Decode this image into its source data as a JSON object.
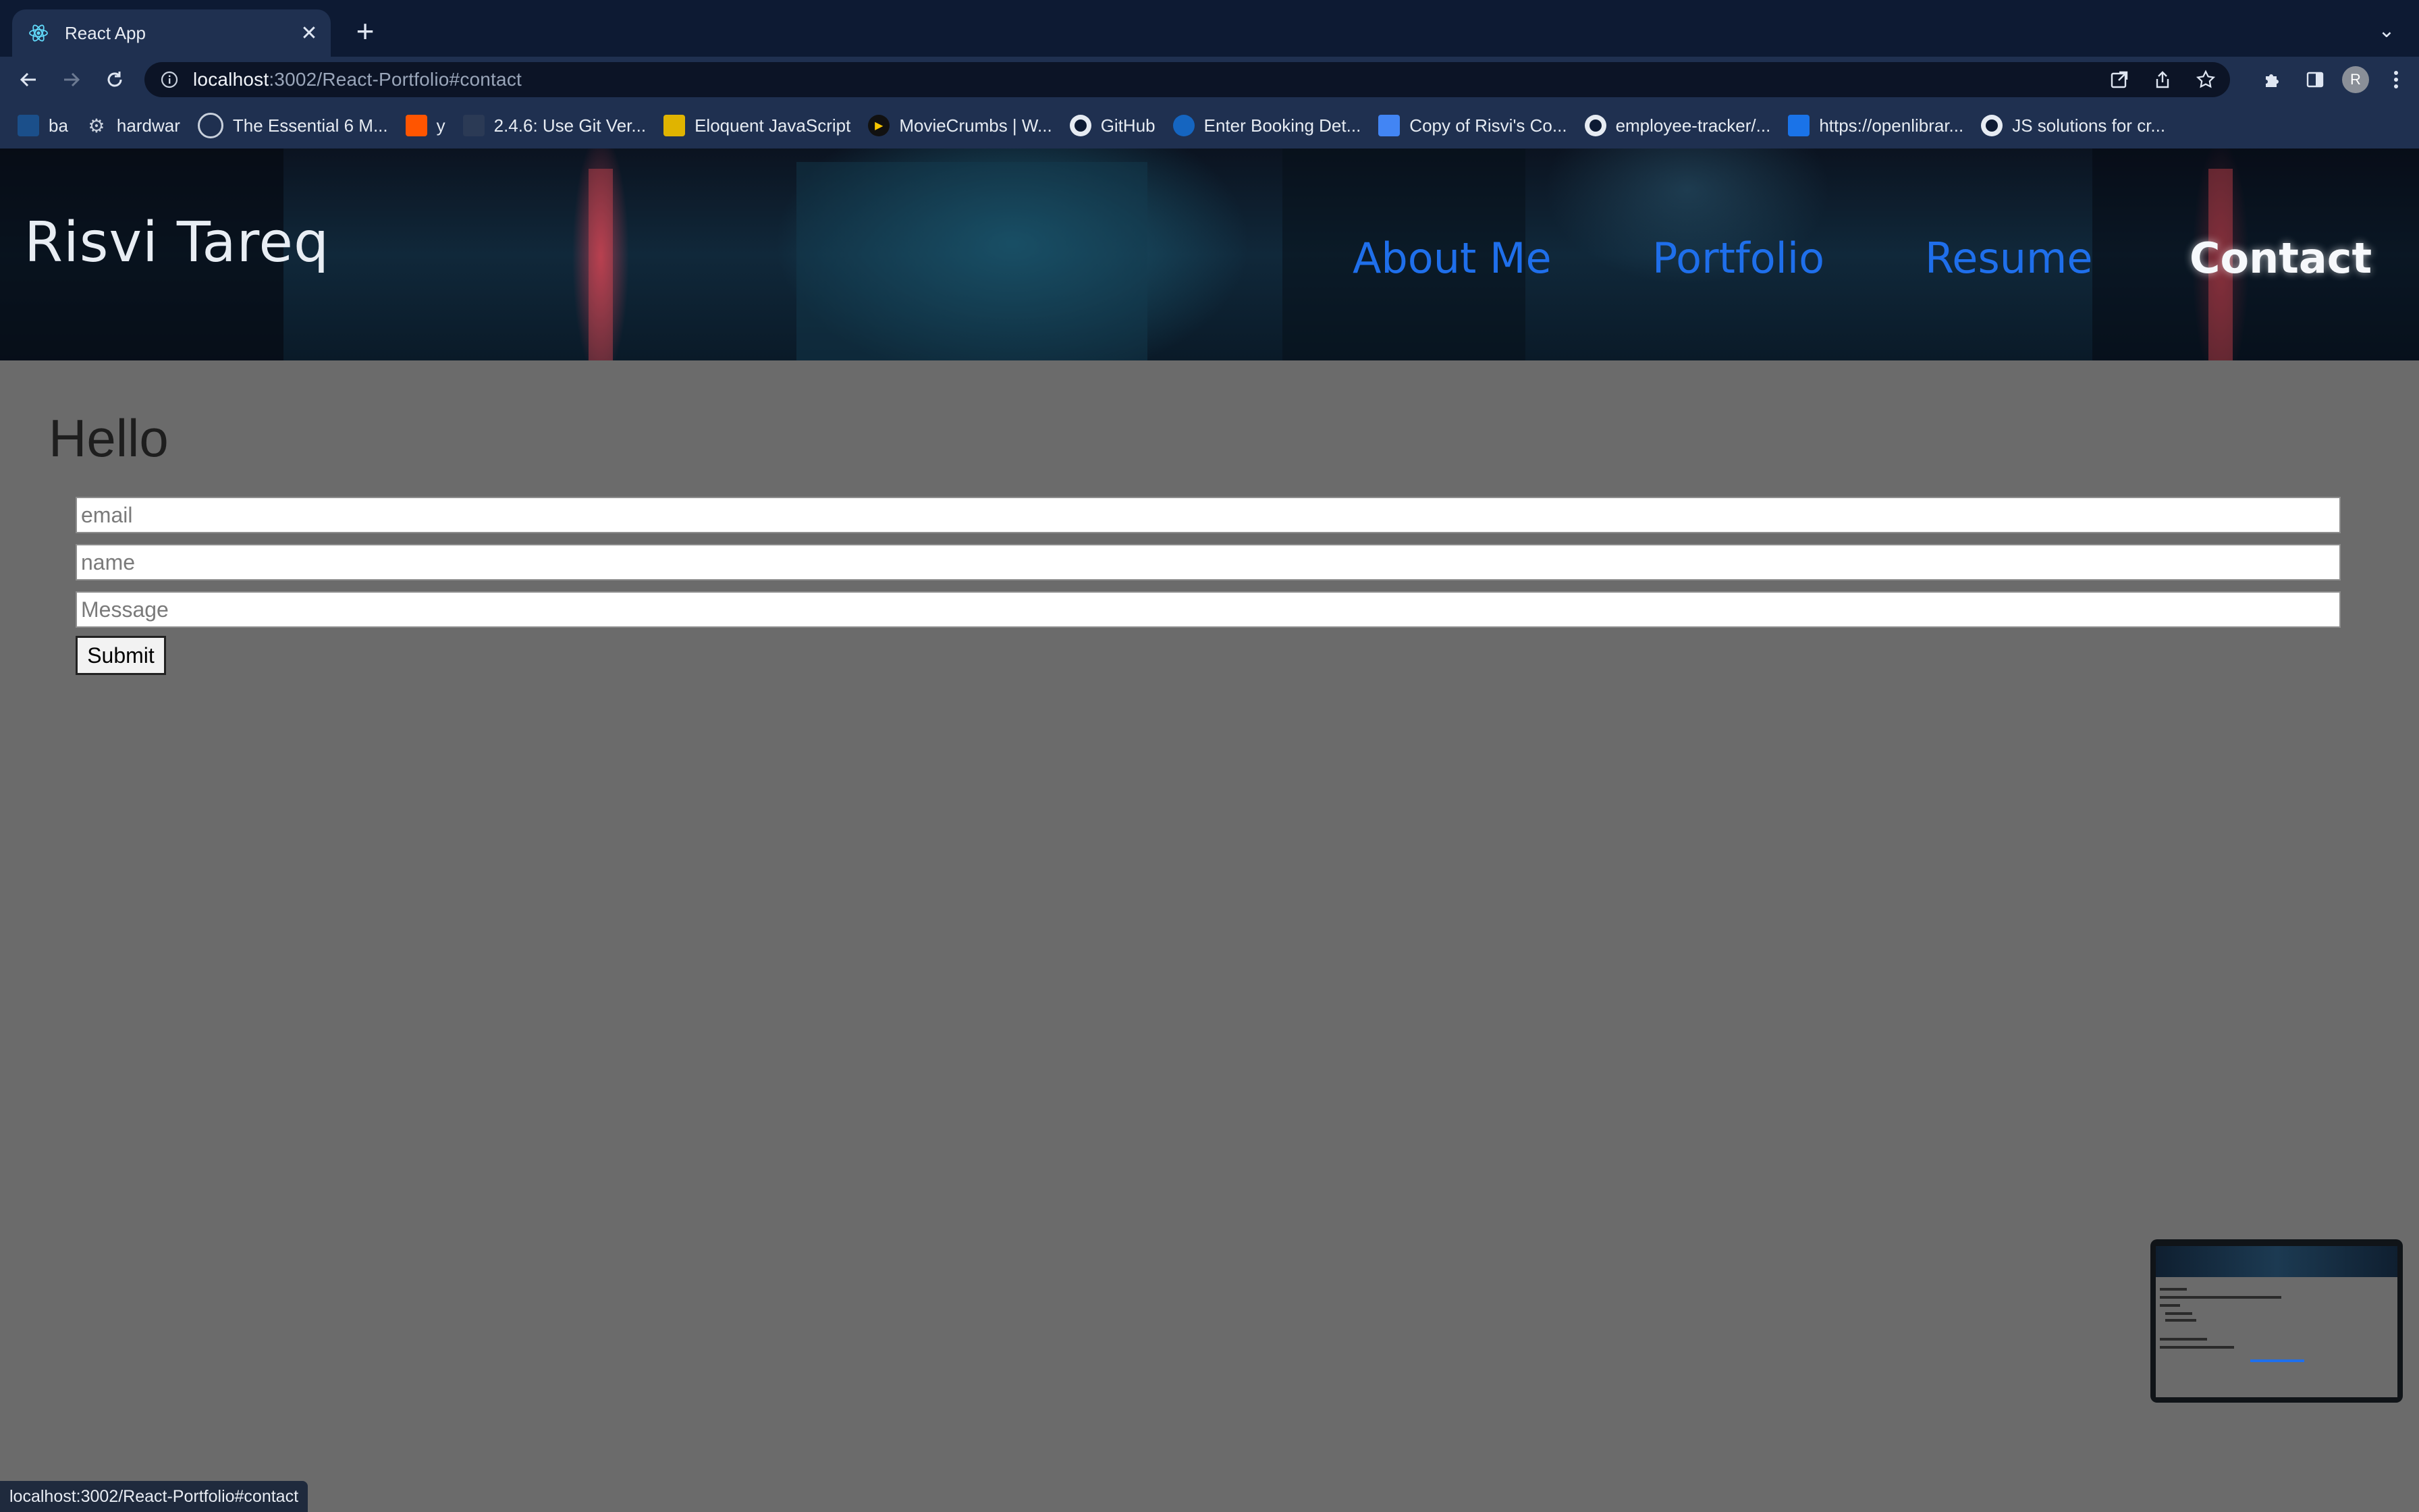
{
  "browser": {
    "tab_title": "React App",
    "url_host": "localhost",
    "url_rest": ":3002/React-Portfolio#contact",
    "bookmarks": [
      {
        "label": "ba",
        "icon": "uci-icon",
        "color": "#1b4f8a"
      },
      {
        "label": "hardwar",
        "icon": "gear-icon",
        "color": "#5a6472"
      },
      {
        "label": "The Essential 6 M...",
        "icon": "globe-icon",
        "color": "#5a6472"
      },
      {
        "label": "y",
        "icon": "soundcloud-icon",
        "color": "#ff5500"
      },
      {
        "label": "2.4.6: Use Git Ver...",
        "icon": "site-icon",
        "color": "#2b3a55"
      },
      {
        "label": "Eloquent JavaScript",
        "icon": "ejs-icon",
        "color": "#e0b400"
      },
      {
        "label": "MovieCrumbs | W...",
        "icon": "play-icon",
        "color": "#111111"
      },
      {
        "label": "GitHub",
        "icon": "github-icon",
        "color": "#0d1a33"
      },
      {
        "label": "Enter Booking Det...",
        "icon": "booking-icon",
        "color": "#1565c0"
      },
      {
        "label": "Copy of Risvi's Co...",
        "icon": "docs-icon",
        "color": "#4285f4"
      },
      {
        "label": "employee-tracker/...",
        "icon": "github-icon",
        "color": "#0d1a33"
      },
      {
        "label": "https://openlibrar...",
        "icon": "openlibrary-icon",
        "color": "#1a73e8"
      },
      {
        "label": "JS solutions for cr...",
        "icon": "github-icon",
        "color": "#0d1a33"
      }
    ],
    "status_url": "localhost:3002/React-Portfolio#contact",
    "avatar_initial": "R"
  },
  "site": {
    "brand": "Risvi Tareq",
    "nav": [
      "About Me",
      "Portfolio",
      "Resume",
      "Contact"
    ],
    "active_nav": "Contact"
  },
  "contact": {
    "heading": "Hello",
    "email_placeholder": "email",
    "name_placeholder": "name",
    "message_placeholder": "Message",
    "submit_label": "Submit"
  },
  "colors": {
    "page_bg": "#6b6b6b",
    "nav_link": "#1f6feb",
    "nav_active": "#f6f8fb"
  }
}
